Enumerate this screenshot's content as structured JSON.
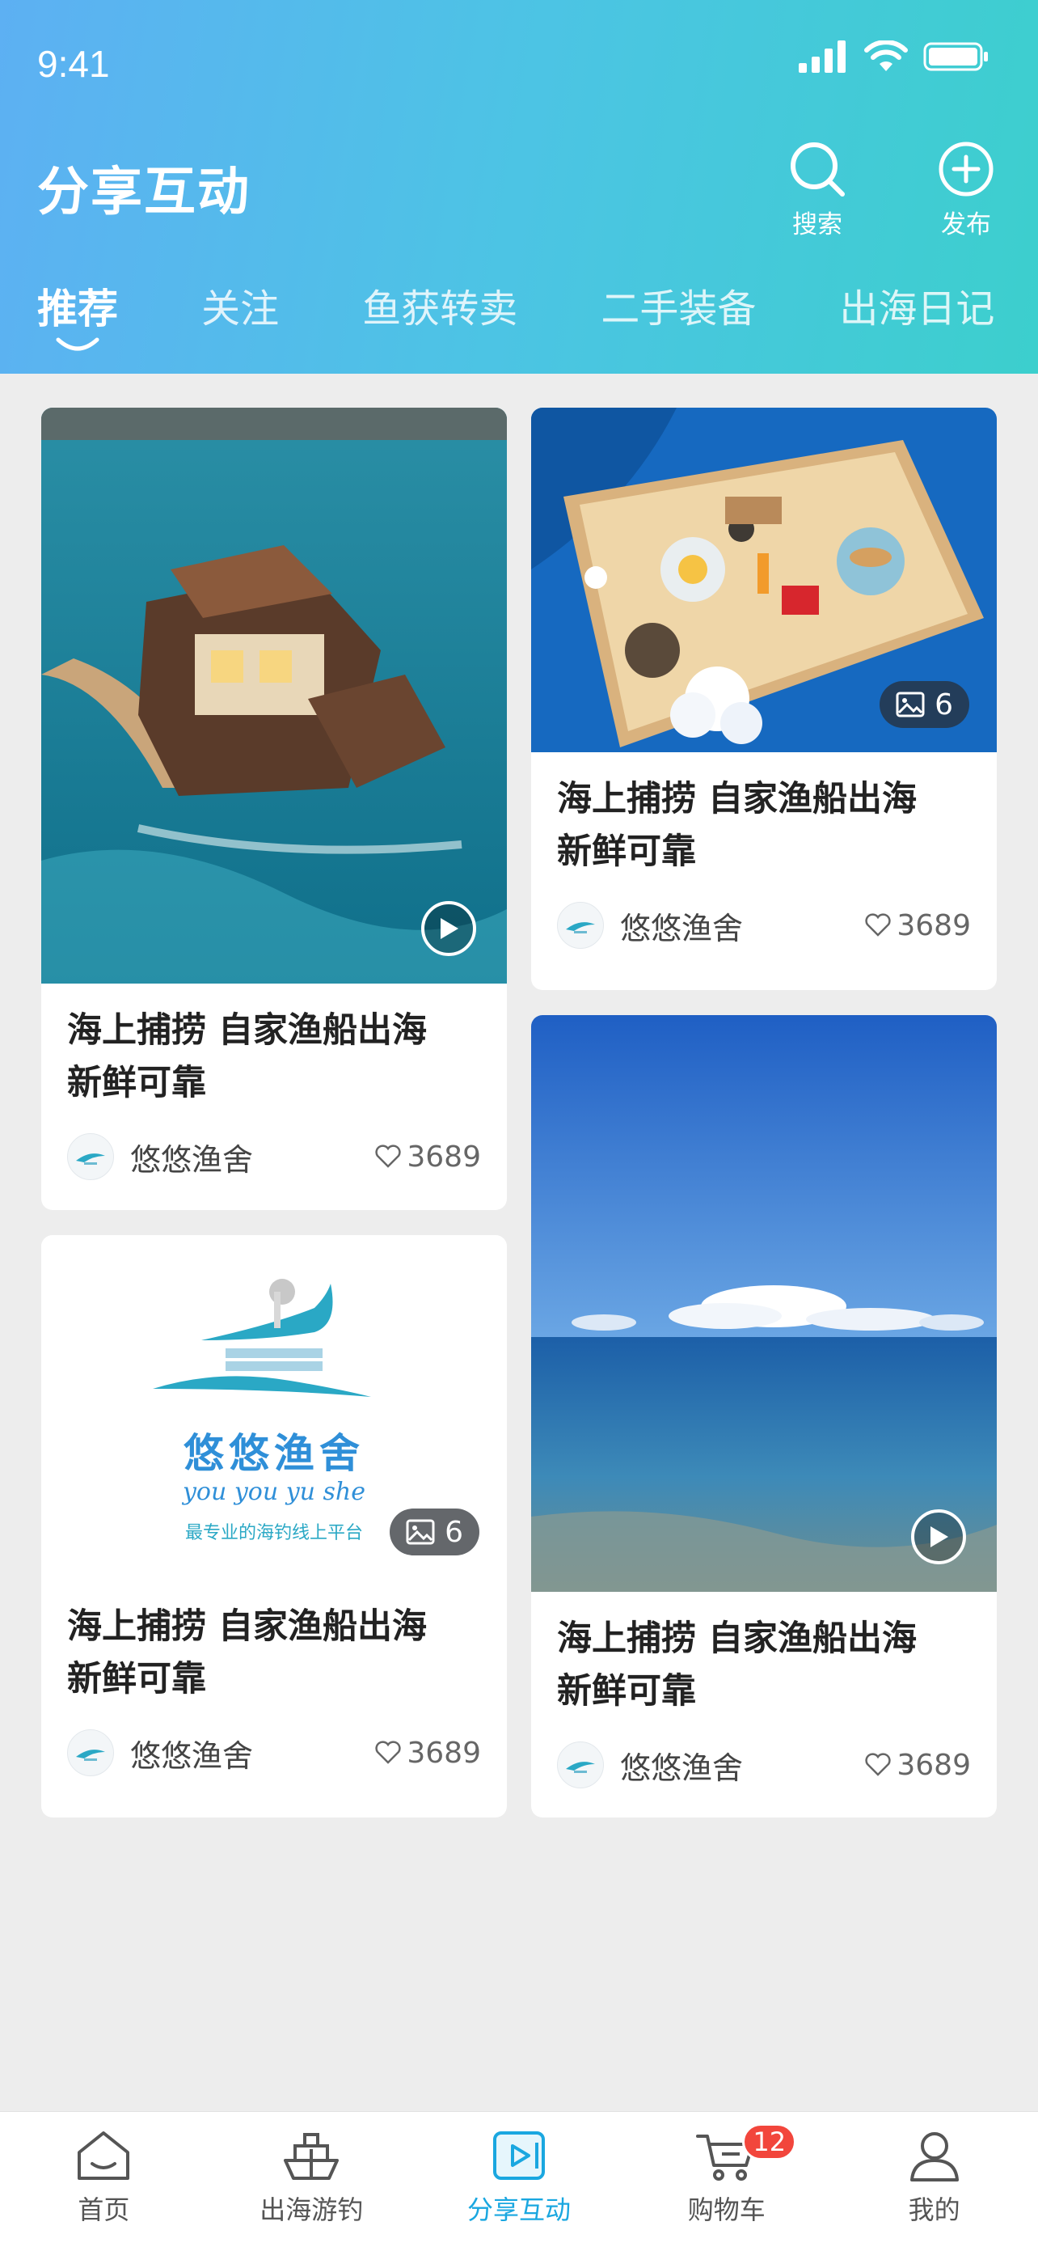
{
  "status_bar": {
    "time": "9:41"
  },
  "header": {
    "title": "分享互动",
    "search_label": "搜索",
    "publish_label": "发布"
  },
  "tabs": [
    {
      "label": "推荐",
      "active": true
    },
    {
      "label": "关注",
      "active": false
    },
    {
      "label": "鱼获转卖",
      "active": false
    },
    {
      "label": "二手装备",
      "active": false
    },
    {
      "label": "出海日记",
      "active": false
    }
  ],
  "brand_logo": {
    "name": "悠悠渔舍",
    "pinyin": "you you yu she",
    "slogan": "最专业的海钓线上平台"
  },
  "posts": [
    {
      "title_line1": "海上捕捞 自家渔船出海",
      "title_line2": "新鲜可靠",
      "author": "悠悠渔舍",
      "likes": "3689",
      "media": "video",
      "media_icon": "play-icon"
    },
    {
      "title_line1": "海上捕捞 自家渔船出海",
      "title_line2": "新鲜可靠",
      "author": "悠悠渔舍",
      "likes": "3689",
      "media": "gallery",
      "photo_count": "6"
    },
    {
      "title_line1": "海上捕捞 自家渔船出海",
      "title_line2": "新鲜可靠",
      "author": "悠悠渔舍",
      "likes": "3689",
      "media": "gallery",
      "photo_count": "6"
    },
    {
      "title_line1": "海上捕捞 自家渔船出海",
      "title_line2": "新鲜可靠",
      "author": "悠悠渔舍",
      "likes": "3689",
      "media": "video",
      "media_icon": "play-icon"
    }
  ],
  "bottom_nav": [
    {
      "label": "首页",
      "icon": "home-icon"
    },
    {
      "label": "出海游钓",
      "icon": "boat-icon"
    },
    {
      "label": "分享互动",
      "icon": "share-play-icon",
      "active": true
    },
    {
      "label": "购物车",
      "icon": "cart-icon",
      "badge": "12"
    },
    {
      "label": "我的",
      "icon": "user-icon"
    }
  ],
  "colors": {
    "accent": "#1aa7e0",
    "header_start": "#5db0f3",
    "header_end": "#3ccfcd",
    "badge": "#f2463c"
  }
}
